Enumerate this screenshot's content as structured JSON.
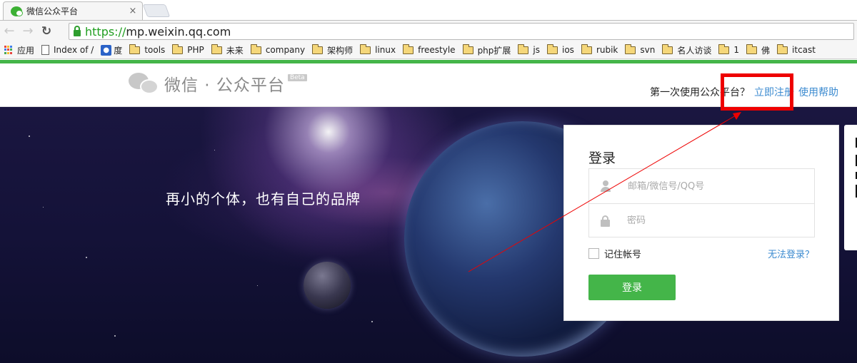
{
  "browser": {
    "tab_title": "微信公众平台",
    "tab_close": "×",
    "url_scheme": "https://",
    "url_host": "mp.weixin.qq.com",
    "bookmarks": {
      "apps": "应用",
      "index_of": "Index of /",
      "baidu": "度",
      "tools": "tools",
      "php": "PHP",
      "weilai": "未来",
      "company": "company",
      "jiagoushi": "架构师",
      "linux": "linux",
      "freestyle": "freestyle",
      "php_ext": "php扩展",
      "js": "js",
      "ios": "ios",
      "rubik": "rubik",
      "svn": "svn",
      "mingren": "名人访谈",
      "one": "1",
      "fo": "佛",
      "itcast": "itcast"
    }
  },
  "header": {
    "logo_text": "微信 · 公众平台",
    "beta": "Beta",
    "first_time": "第一次使用公众平台？",
    "register": "立即注册",
    "help": "使用帮助"
  },
  "banner": {
    "slogan": "再小的个体，也有自己的品牌"
  },
  "login": {
    "title": "登录",
    "account_placeholder": "邮箱/微信号/QQ号",
    "password_placeholder": "密码",
    "remember": "记住帐号",
    "forgot": "无法登录？",
    "submit": "登录"
  },
  "colors": {
    "brand_green": "#44b549",
    "link_blue": "#3c8bd0",
    "annotation_red": "#ee0000"
  }
}
